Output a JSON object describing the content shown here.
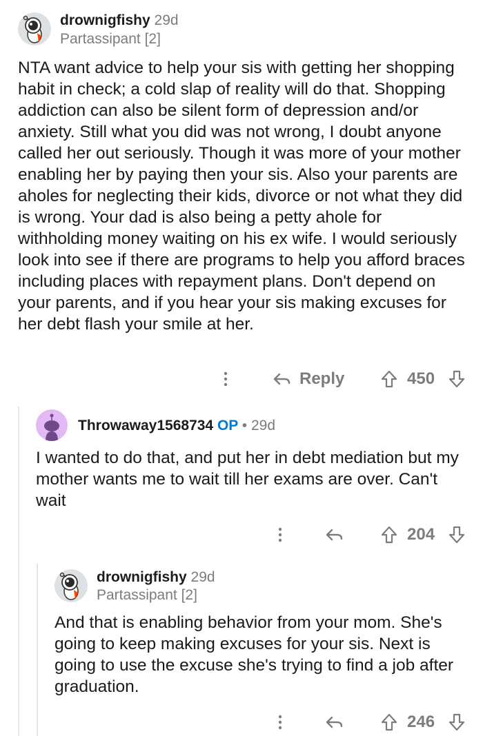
{
  "comments": [
    {
      "username": "drownigfishy",
      "age": "29d",
      "flair": "Partassipant [2]",
      "body": "NTA want advice to help your sis with getting her shopping habit in check; a cold slap of reality will do that. Shopping addiction can also be  silent form of depression and/or anxiety. Still what you did was not wrong, I doubt anyone called her out seriously. Though it was more of your mother enabling her by paying then your sis. Also your parents are aholes for neglecting their kids, divorce or not what they did is wrong. Your dad is also being a petty ahole for withholding money waiting on his ex wife. I would seriously look into see if there are programs to help you afford braces including places with repayment plans. Don't depend on your parents, and if you hear your sis making excuses for her debt flash your smile at her.",
      "reply_label": "Reply",
      "votes": "450"
    },
    {
      "username": "Throwaway1568734",
      "op_tag": "OP",
      "separator": "•",
      "age": "29d",
      "body": "I wanted to do that, and put her in debt mediation but my mother wants me to wait till her exams are over. Can't wait",
      "votes": "204"
    },
    {
      "username": "drownigfishy",
      "age": "29d",
      "flair": "Partassipant [2]",
      "body": "And that is enabling behavior from your mom. She's going to keep making excuses for your sis. Next is going to use the excuse she's trying to find a job after graduation.",
      "votes": "246"
    }
  ],
  "colors": {
    "text": "#1a1a1b",
    "muted": "#7c7c7c",
    "op_blue": "#0079d3",
    "thread_line": "#e3e5e8",
    "snoo_purple": "#d6a0f0"
  },
  "icons": {
    "avatar_1": "astronaut-snoo-avatar",
    "avatar_2": "default-snoo-avatar",
    "more": "more-vertical-icon",
    "reply": "reply-arrow-icon",
    "upvote": "upvote-arrow-icon",
    "downvote": "downvote-arrow-icon"
  }
}
